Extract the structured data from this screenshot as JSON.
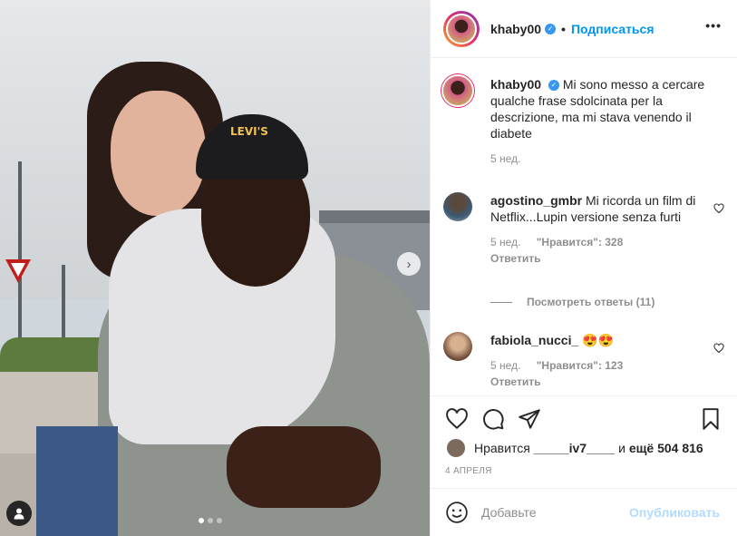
{
  "header": {
    "username": "khaby00",
    "separator": "•",
    "follow_label": "Подписаться",
    "more_label": "•••"
  },
  "caption": {
    "username": "khaby00",
    "text": "Mi sono messo a cercare qualche frase sdolcinata per la descrizione, ma mi stava venendo il diabete",
    "time": "5 нед."
  },
  "comments": [
    {
      "username": "agostino_gmbr",
      "text": "Mi ricorda un film di Netflix...Lupin versione senza furti",
      "time": "5 нед.",
      "likes": "\"Нравится\": 328",
      "reply_label": "Ответить",
      "view_replies": "Посмотреть ответы (11)"
    },
    {
      "username": "fabiola_nucci_",
      "text": "😍😍",
      "time": "5 нед.",
      "likes": "\"Нравится\": 123",
      "reply_label": "Ответить"
    }
  ],
  "likes": {
    "prefix": "Нравится",
    "user": "_____iv7____",
    "middle": "и",
    "count": "ещё 504 816"
  },
  "date": "4 АПРЕЛЯ",
  "comment_box": {
    "placeholder": "Добавьте",
    "post_label": "Опубликовать"
  },
  "carousel": {
    "current": 1,
    "total": 3
  },
  "photo_text": {
    "cap_brand": "LEVI'S"
  },
  "colors": {
    "accent": "#0095f6",
    "verified": "#3897f0",
    "muted": "#8e8e8e",
    "post_disabled": "#b3dbff"
  }
}
